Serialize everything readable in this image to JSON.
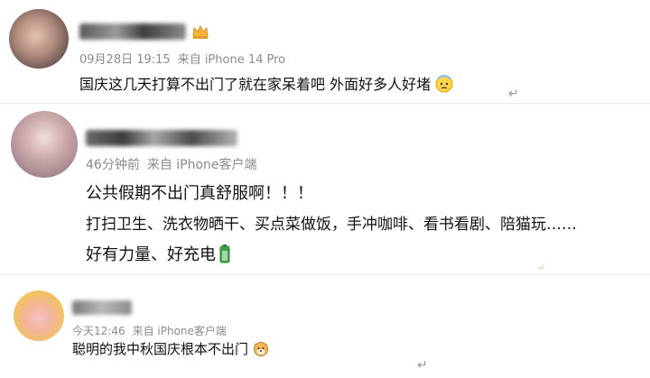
{
  "comments": [
    {
      "time": "09月28日 19:15",
      "source": "来自 iPhone 14 Pro",
      "lines": [
        "国庆这几天打算不出门了就在家呆着吧 外面好多人好堵"
      ],
      "emoji": "cold-sweat-emoji"
    },
    {
      "time": "46分钟前",
      "source": "来自 iPhone客户端",
      "lines": [
        "公共假期不出门真舒服啊！！！",
        "打扫卫生、洗衣物晒干、买点菜做饭，手冲咖啡、看书看剧、陪猫玩……",
        "好有力量、好充电"
      ],
      "emoji": "battery-emoji"
    },
    {
      "time": "今天12:46",
      "source": "来自 iPhone客户端",
      "lines": [
        "聪明的我中秋国庆根本不出门"
      ],
      "emoji": "shiba-dog-emoji"
    }
  ],
  "return_glyph": "↵",
  "colors": {
    "meta_text": "#8a8a8a",
    "body_text": "#111111",
    "divider": "#ececec"
  }
}
